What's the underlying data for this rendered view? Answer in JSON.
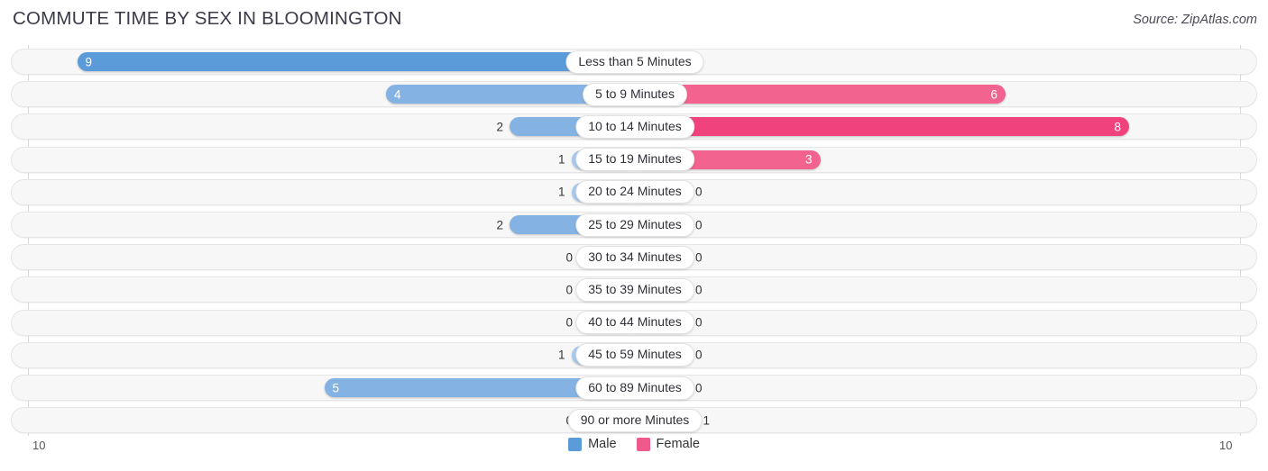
{
  "header": {
    "title": "COMMUTE TIME BY SEX IN BLOOMINGTON",
    "source": "Source: ZipAtlas.com"
  },
  "axis": {
    "left_label": "10",
    "right_label": "10",
    "max": 10
  },
  "legend": [
    {
      "label": "Male",
      "color": "#5b9bd9"
    },
    {
      "label": "Female",
      "color": "#f0598c"
    }
  ],
  "colors": {
    "male_strong": "#5b9bd9",
    "male_mid": "#84b2e3",
    "male_light": "#a8c8ee",
    "female_strong": "#f0437e",
    "female_mid": "#f2638f",
    "female_light": "#f79dbd",
    "track": "#f7f7f7",
    "track_border": "#e6e6e6"
  },
  "chart_data": {
    "type": "bar",
    "subtype": "diverging-horizontal",
    "title": "COMMUTE TIME BY SEX IN BLOOMINGTON",
    "xlabel": "",
    "ylabel": "",
    "xlim": [
      -10,
      10
    ],
    "grid": false,
    "legend_position": "bottom-center",
    "categories": [
      "Less than 5 Minutes",
      "5 to 9 Minutes",
      "10 to 14 Minutes",
      "15 to 19 Minutes",
      "20 to 24 Minutes",
      "25 to 29 Minutes",
      "30 to 34 Minutes",
      "35 to 39 Minutes",
      "40 to 44 Minutes",
      "45 to 59 Minutes",
      "60 to 89 Minutes",
      "90 or more Minutes"
    ],
    "series": [
      {
        "name": "Male",
        "values": [
          9,
          4,
          2,
          1,
          1,
          2,
          0,
          0,
          0,
          1,
          5,
          0
        ]
      },
      {
        "name": "Female",
        "values": [
          0,
          6,
          8,
          3,
          0,
          0,
          0,
          0,
          0,
          0,
          0,
          1
        ]
      }
    ]
  },
  "rows": [
    {
      "label": "Less than 5 Minutes",
      "male": "9",
      "female": "0",
      "male_value": 9,
      "female_value": 0
    },
    {
      "label": "5 to 9 Minutes",
      "male": "4",
      "female": "6",
      "male_value": 4,
      "female_value": 6
    },
    {
      "label": "10 to 14 Minutes",
      "male": "2",
      "female": "8",
      "male_value": 2,
      "female_value": 8
    },
    {
      "label": "15 to 19 Minutes",
      "male": "1",
      "female": "3",
      "male_value": 1,
      "female_value": 3
    },
    {
      "label": "20 to 24 Minutes",
      "male": "1",
      "female": "0",
      "male_value": 1,
      "female_value": 0
    },
    {
      "label": "25 to 29 Minutes",
      "male": "2",
      "female": "0",
      "male_value": 2,
      "female_value": 0
    },
    {
      "label": "30 to 34 Minutes",
      "male": "0",
      "female": "0",
      "male_value": 0,
      "female_value": 0
    },
    {
      "label": "35 to 39 Minutes",
      "male": "0",
      "female": "0",
      "male_value": 0,
      "female_value": 0
    },
    {
      "label": "40 to 44 Minutes",
      "male": "0",
      "female": "0",
      "male_value": 0,
      "female_value": 0
    },
    {
      "label": "45 to 59 Minutes",
      "male": "1",
      "female": "0",
      "male_value": 1,
      "female_value": 0
    },
    {
      "label": "60 to 89 Minutes",
      "male": "5",
      "female": "0",
      "male_value": 5,
      "female_value": 0
    },
    {
      "label": "90 or more Minutes",
      "male": "0",
      "female": "1",
      "male_value": 0,
      "female_value": 1
    }
  ]
}
